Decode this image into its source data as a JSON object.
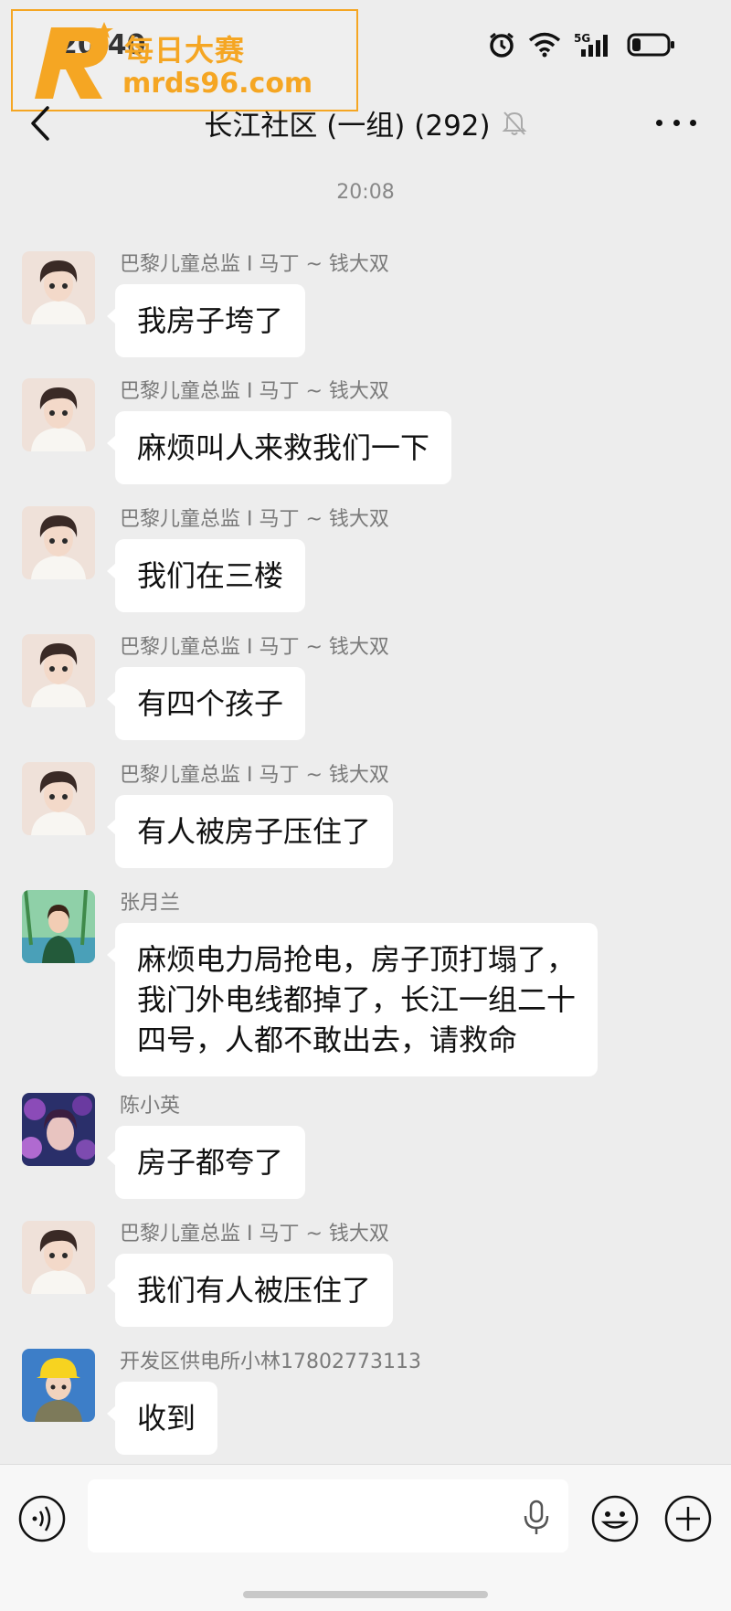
{
  "status_bar": {
    "time": "20:40"
  },
  "watermark": {
    "logo_letter": "R",
    "title": "每日大赛",
    "url": "mrds96.com"
  },
  "header": {
    "title": "长江社区 (一组) (292)"
  },
  "chat": {
    "time_divider": "20:08",
    "messages": [
      {
        "sender": "巴黎儿童总监 I 马丁 ~ 钱大双",
        "text": "我房子垮了",
        "avatar": "avatar-boy"
      },
      {
        "sender": "巴黎儿童总监 I 马丁 ~ 钱大双",
        "text": "麻烦叫人来救我们一下",
        "avatar": "avatar-boy"
      },
      {
        "sender": "巴黎儿童总监 I 马丁 ~ 钱大双",
        "text": "我们在三楼",
        "avatar": "avatar-boy"
      },
      {
        "sender": "巴黎儿童总监 I 马丁 ~ 钱大双",
        "text": "有四个孩子",
        "avatar": "avatar-boy"
      },
      {
        "sender": "巴黎儿童总监 I 马丁 ~ 钱大双",
        "text": "有人被房子压住了",
        "avatar": "avatar-boy"
      },
      {
        "sender": "张月兰",
        "text": "麻烦电力局抢电，房子顶打塌了，\n我门外电线都掉了，长江一组二十\n四号，人都不敢出去，请救命",
        "avatar": "avatar-woman-green"
      },
      {
        "sender": "陈小英",
        "text": "房子都夸了",
        "avatar": "avatar-woman-flowers"
      },
      {
        "sender": "巴黎儿童总监 I 马丁 ~ 钱大双",
        "text": "我们有人被压住了",
        "avatar": "avatar-boy"
      },
      {
        "sender": "开发区供电所小林17802773113",
        "text": "收到",
        "avatar": "avatar-worker"
      }
    ]
  },
  "input_bar": {
    "value": "",
    "placeholder": ""
  },
  "colors": {
    "background": "#ededed",
    "bubble": "#ffffff",
    "watermark": "#f5a623"
  }
}
